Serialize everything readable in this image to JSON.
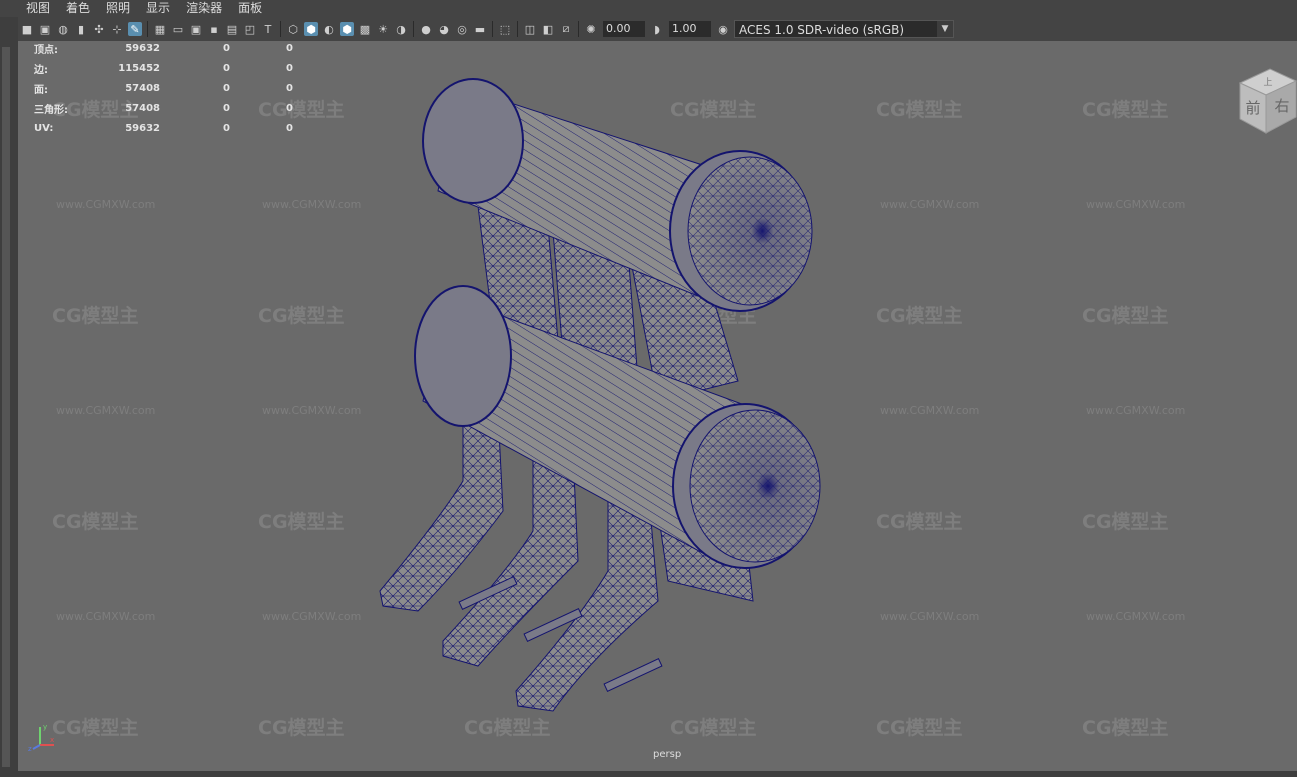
{
  "menu": [
    "视图",
    "着色",
    "照明",
    "显示",
    "渲染器",
    "面板"
  ],
  "toolbar": {
    "exposure": "0.00",
    "gamma": "1.00",
    "colorspace": "ACES 1.0 SDR-video (sRGB)",
    "icons": [
      "camera-icon",
      "bookmark-icon",
      "grid-icon",
      "wireframe-icon",
      "shaded-icon",
      "xray-icon",
      "light-icon",
      "shadow-icon",
      "isolate-icon",
      "resolution-gate-icon"
    ]
  },
  "hud": {
    "rows": [
      {
        "label": "顶点:",
        "a": "59632",
        "b": "0",
        "c": "0"
      },
      {
        "label": "边:",
        "a": "115452",
        "b": "0",
        "c": "0"
      },
      {
        "label": "面:",
        "a": "57408",
        "b": "0",
        "c": "0"
      },
      {
        "label": "三角形:",
        "a": "57408",
        "b": "0",
        "c": "0"
      },
      {
        "label": "UV:",
        "a": "59632",
        "b": "0",
        "c": "0"
      }
    ]
  },
  "watermark": {
    "logo": "CG模型主",
    "url": "www.CGMXW.com"
  },
  "viewcube": {
    "top": "上",
    "front": "前",
    "right": "右"
  },
  "camera_label": "persp",
  "axis": {
    "x": "x",
    "y": "y",
    "z": "z"
  }
}
